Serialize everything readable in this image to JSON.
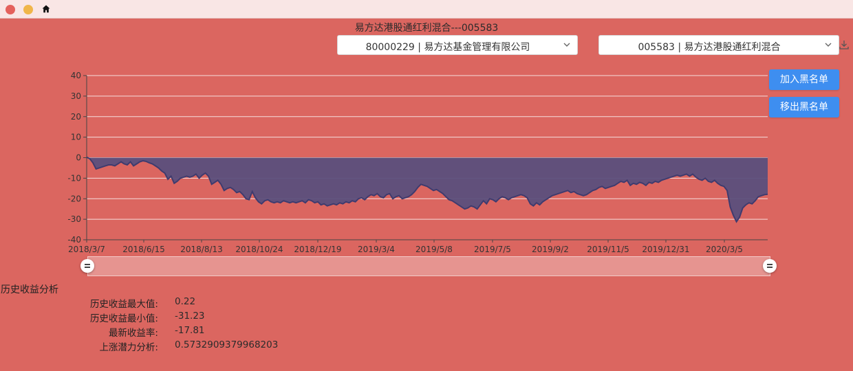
{
  "window": {
    "icons": [
      "close-dot",
      "minimize-dot",
      "home-icon"
    ]
  },
  "page": {
    "title": "易方达港股通红利混合---005583"
  },
  "selects": {
    "company": "80000229 | 易方达基金管理有限公司",
    "fund": "005583 | 易方达港股通红利混合"
  },
  "buttons": {
    "add_blacklist": "加入黑名单",
    "remove_blacklist": "移出黑名单"
  },
  "colors": {
    "background": "#db6660",
    "series_fill": "#5b4f7c",
    "series_line": "#3f3b6e",
    "button": "#3e8ef0"
  },
  "chart_data": {
    "type": "area",
    "y_ticks": [
      "40",
      "30",
      "20",
      "10",
      "0",
      "-10",
      "-20",
      "-30",
      "-40"
    ],
    "ylim": [
      -40,
      40
    ],
    "x_tick_labels": [
      "2018/3/7",
      "2018/6/15",
      "2018/8/13",
      "2018/10/24",
      "2018/12/19",
      "2019/3/4",
      "2019/5/8",
      "2019/7/5",
      "2019/9/2",
      "2019/11/5",
      "2019/12/31",
      "2020/3/5"
    ],
    "series": [
      {
        "values": [
          0.22,
          -0.5,
          -2.5,
          -5.5,
          -5.0,
          -4.5,
          -4.0,
          -3.5,
          -3.5,
          -4.0,
          -3.0,
          -2.0,
          -3.0,
          -3.5,
          -2.0,
          -4.0,
          -3.0,
          -2.0,
          -1.5,
          -1.8,
          -2.5,
          -3.0,
          -4.0,
          -5.0,
          -6.5,
          -7.5,
          -10.5,
          -9.0,
          -12.5,
          -11.5,
          -10.0,
          -9.5,
          -9.0,
          -9.5,
          -9.0,
          -8.0,
          -10.0,
          -8.5,
          -7.5,
          -9.0,
          -13.0,
          -12.0,
          -11.0,
          -13.0,
          -16.0,
          -15.0,
          -14.5,
          -15.5,
          -17.0,
          -16.5,
          -18.0,
          -20.0,
          -20.5,
          -16.5,
          -19.5,
          -21.5,
          -22.5,
          -21.0,
          -20.5,
          -21.5,
          -22.0,
          -21.5,
          -22.0,
          -21.0,
          -21.5,
          -22.0,
          -21.5,
          -22.0,
          -21.5,
          -21.0,
          -22.0,
          -20.5,
          -21.0,
          -22.0,
          -21.5,
          -23.0,
          -22.5,
          -23.5,
          -23.0,
          -22.5,
          -23.0,
          -22.0,
          -22.5,
          -21.5,
          -22.0,
          -21.0,
          -21.5,
          -20.0,
          -19.5,
          -20.5,
          -19.0,
          -18.0,
          -18.5,
          -17.5,
          -19.0,
          -19.5,
          -18.0,
          -17.5,
          -20.0,
          -19.0,
          -18.5,
          -20.0,
          -19.5,
          -19.0,
          -18.0,
          -16.5,
          -14.5,
          -13.0,
          -13.5,
          -14.0,
          -15.0,
          -16.0,
          -15.5,
          -16.5,
          -17.5,
          -19.0,
          -20.5,
          -21.0,
          -22.0,
          -23.0,
          -24.0,
          -25.0,
          -24.5,
          -23.5,
          -24.0,
          -25.0,
          -23.0,
          -21.0,
          -22.5,
          -20.0,
          -20.5,
          -21.5,
          -20.0,
          -19.0,
          -19.5,
          -20.5,
          -19.5,
          -19.0,
          -18.5,
          -18.0,
          -18.5,
          -19.5,
          -22.5,
          -23.5,
          -22.0,
          -23.0,
          -21.5,
          -20.5,
          -19.5,
          -18.5,
          -18.0,
          -17.5,
          -17.0,
          -16.5,
          -16.0,
          -17.0,
          -16.5,
          -17.5,
          -18.0,
          -18.5,
          -18.0,
          -17.0,
          -16.0,
          -15.5,
          -14.5,
          -14.0,
          -15.0,
          -14.5,
          -14.0,
          -13.5,
          -12.5,
          -11.5,
          -12.0,
          -11.0,
          -13.5,
          -12.5,
          -13.0,
          -12.0,
          -12.5,
          -13.5,
          -12.0,
          -12.5,
          -11.5,
          -12.0,
          -11.0,
          -10.5,
          -10.0,
          -9.5,
          -9.0,
          -8.5,
          -9.0,
          -8.5,
          -8.0,
          -9.0,
          -8.0,
          -9.5,
          -10.5,
          -11.0,
          -10.0,
          -11.5,
          -12.0,
          -11.0,
          -12.5,
          -13.5,
          -14.0,
          -16.0,
          -24.0,
          -28.0,
          -31.23,
          -29.0,
          -24.5,
          -23.0,
          -22.0,
          -22.5,
          -21.0,
          -19.0,
          -18.5,
          -18.0,
          -17.81
        ]
      }
    ]
  },
  "analysis": {
    "title": "历史收益分析",
    "rows": [
      {
        "label": "历史收益最大值:",
        "value": "0.22"
      },
      {
        "label": "历史收益最小值:",
        "value": "-31.23"
      },
      {
        "label": "最新收益率:",
        "value": "-17.81"
      },
      {
        "label": "上涨潜力分析:",
        "value": "0.5732909379968203"
      }
    ]
  }
}
